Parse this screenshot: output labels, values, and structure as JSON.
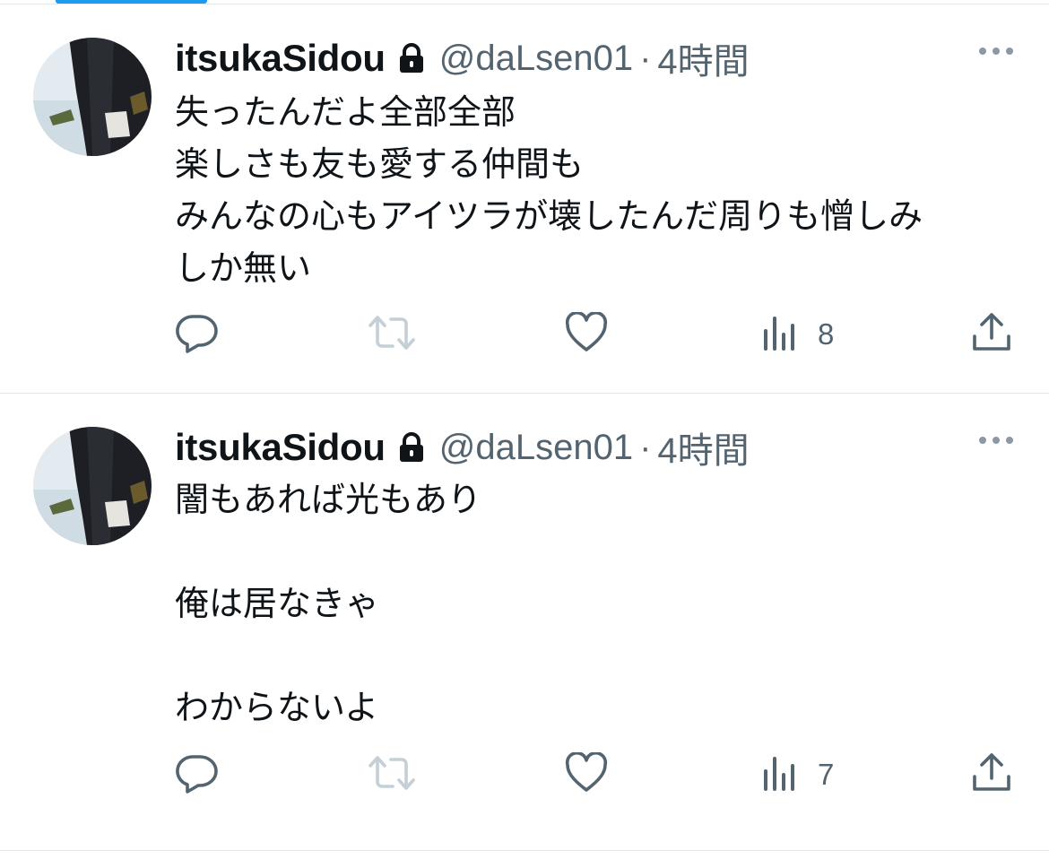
{
  "colors": {
    "accent": "#1d9bf0",
    "text_primary": "#0f1419",
    "text_secondary": "#536471",
    "retweet_disabled": "#c4cfd6",
    "divider": "#e6e9ec"
  },
  "tweets": [
    {
      "display_name": "itsukaSidou",
      "protected_icon": "lock-icon",
      "handle": "@daLsen01",
      "separator": "·",
      "time": "4時間",
      "text": "失ったんだよ全部全部\n楽しさも友も愛する仲間も\nみんなの心もアイツラが壊したんだ周りも憎しみ\nしか無い",
      "actions": {
        "reply_icon": "reply-icon",
        "retweet_icon": "retweet-icon",
        "like_icon": "heart-icon",
        "views_icon": "views-icon",
        "views_count": "8",
        "share_icon": "share-icon"
      }
    },
    {
      "display_name": "itsukaSidou",
      "protected_icon": "lock-icon",
      "handle": "@daLsen01",
      "separator": "·",
      "time": "4時間",
      "text": "闇もあれば光もあり\n\n俺は居なきゃ\n\nわからないよ",
      "actions": {
        "reply_icon": "reply-icon",
        "retweet_icon": "retweet-icon",
        "like_icon": "heart-icon",
        "views_icon": "views-icon",
        "views_count": "7",
        "share_icon": "share-icon"
      }
    }
  ]
}
